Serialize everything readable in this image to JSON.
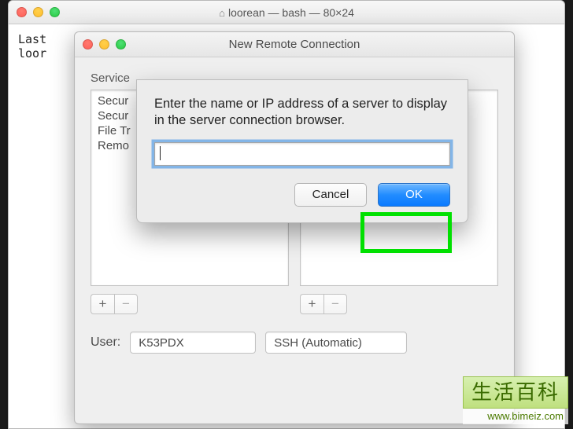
{
  "terminal": {
    "title": "loorean — bash — 80×24",
    "body_line1": "Last",
    "body_line2": "loor"
  },
  "nrc": {
    "title": "New Remote Connection",
    "service_label": "Service",
    "services": [
      "Secur",
      "Secur",
      "File Tr",
      "Remo"
    ],
    "add_label": "+",
    "remove_label": "−",
    "user_label": "User:",
    "user_value": "K53PDX",
    "ssh_value": "SSH (Automatic)"
  },
  "prompt": {
    "message": "Enter the name or IP address of a server to display in the server connection browser.",
    "input_value": "",
    "cancel_label": "Cancel",
    "ok_label": "OK"
  },
  "watermark": {
    "brand": "生活百科",
    "url": "www.bimeiz.com"
  }
}
